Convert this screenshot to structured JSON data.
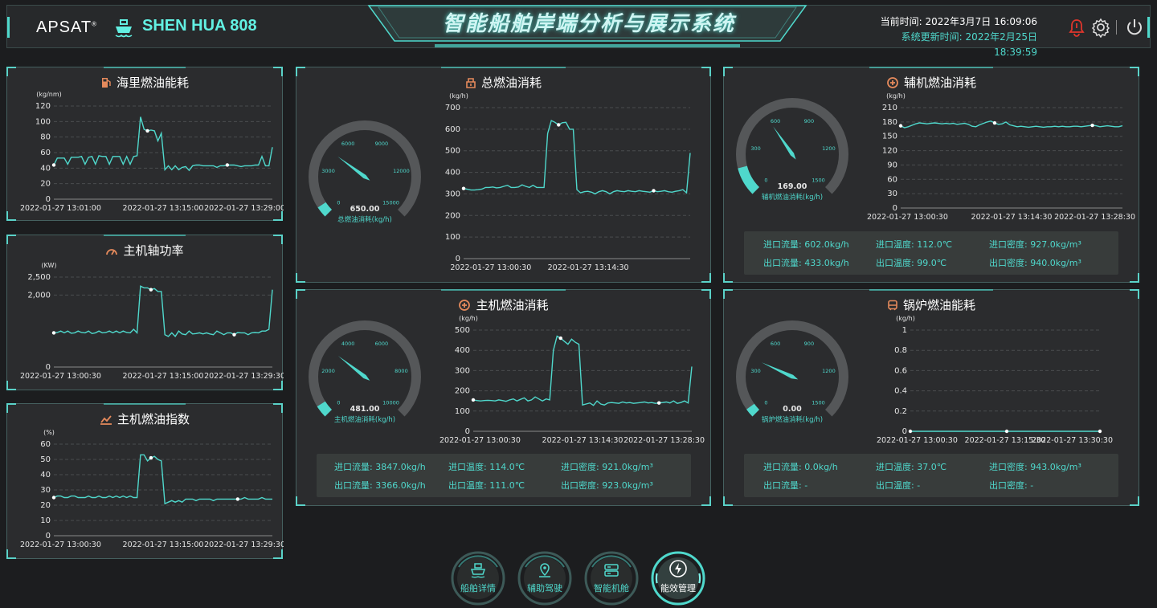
{
  "header": {
    "logo": "APSAT",
    "ship_name": "SHEN HUA 808",
    "system_name": "智能船舶岸端分析与展示系统",
    "current_time_label": "当前时间:",
    "current_time": "2022年3月7日 16:09:06",
    "update_time_label": "系统更新时间:",
    "update_time": "2022年2月25日 18:39:59",
    "icons": [
      "alarm-icon",
      "gear-icon",
      "power-icon"
    ]
  },
  "colors": {
    "accent": "#4fd8cc",
    "bg": "#1c1d1f",
    "panel": "#2b2c2e",
    "gauge_track": "#555759",
    "icon_orange": "#e58a5c",
    "alarm": "#e0362c"
  },
  "panels": {
    "nm": {
      "title": "海里燃油能耗",
      "icon": "fuel-pump-icon"
    },
    "shaft": {
      "title": "主机轴功率",
      "icon": "speedometer-icon"
    },
    "index": {
      "title": "主机燃油指数",
      "icon": "trend-chart-icon"
    },
    "total": {
      "title": "总燃油消耗",
      "icon": "fuel-tank-icon",
      "gauge": {
        "value_text": "650.00",
        "label": "总燃油消耗(kg/h)",
        "ticks": [
          "0",
          "3000",
          "6000",
          "9000",
          "12000",
          "15000"
        ],
        "value": 650,
        "max": 15000
      }
    },
    "aux": {
      "title": "辅机燃油消耗",
      "icon": "engine-icon",
      "gauge": {
        "value_text": "169.00",
        "label": "辅机燃油消耗(kg/h)",
        "ticks": [
          "0",
          "300",
          "600",
          "900",
          "1200",
          "1500"
        ],
        "value": 169,
        "max": 1500
      },
      "info": {
        "in_flow": "进口流量: 602.0kg/h",
        "in_temp": "进口温度: 112.0℃",
        "in_density": "进口密度: 927.0kg/m³",
        "out_flow": "出口流量: 433.0kg/h",
        "out_temp": "出口温度: 99.0℃",
        "out_density": "出口密度: 940.0kg/m³"
      }
    },
    "main": {
      "title": "主机燃油消耗",
      "icon": "engine-icon",
      "gauge": {
        "value_text": "481.00",
        "label": "主机燃油消耗(kg/h)",
        "ticks": [
          "0",
          "2000",
          "4000",
          "6000",
          "8000",
          "10000"
        ],
        "value": 481,
        "max": 10000
      },
      "info": {
        "in_flow": "进口流量: 3847.0kg/h",
        "in_temp": "进口温度: 114.0℃",
        "in_density": "进口密度: 921.0kg/m³",
        "out_flow": "出口流量: 3366.0kg/h",
        "out_temp": "出口温度: 111.0℃",
        "out_density": "出口密度: 923.0kg/m³"
      }
    },
    "boiler": {
      "title": "锅炉燃油能耗",
      "icon": "boiler-icon",
      "gauge": {
        "value_text": "0.00",
        "label": "锅炉燃油消耗(kg/h)",
        "ticks": [
          "0",
          "300",
          "600",
          "900",
          "1200",
          "1500"
        ],
        "value": 0,
        "max": 1500
      },
      "info": {
        "in_flow": "进口流量: 0.0kg/h",
        "in_temp": "进口温度: 37.0℃",
        "in_density": "进口密度: 943.0kg/m³",
        "out_flow": "出口流量: -",
        "out_temp": "出口温度: -",
        "out_density": "出口密度: -"
      }
    }
  },
  "nav": [
    {
      "label": "船舶详情",
      "icon": "ship-icon",
      "active": false
    },
    {
      "label": "辅助驾驶",
      "icon": "location-pin-icon",
      "active": false
    },
    {
      "label": "智能机舱",
      "icon": "server-icon",
      "active": false
    },
    {
      "label": "能效管理",
      "icon": "lightning-icon",
      "active": true
    }
  ],
  "chart_data": [
    {
      "id": "nm",
      "type": "line",
      "unit": "(kg/nm)",
      "ylim": [
        0,
        120
      ],
      "yticks": [
        "0",
        "20",
        "40",
        "60",
        "80",
        "100",
        "120"
      ],
      "xtick_labels": [
        "2022-01-27 13:01:00",
        "2022-01-27 13:15:00",
        "2022-01-27 13:29:00"
      ],
      "values": [
        44,
        53,
        53,
        53,
        45,
        54,
        54,
        54,
        55,
        45,
        54,
        55,
        45,
        56,
        55,
        55,
        45,
        55,
        55,
        55,
        45,
        55,
        45,
        55,
        56,
        106,
        90,
        88,
        89,
        88,
        75,
        85,
        38,
        43,
        38,
        43,
        38,
        41,
        42,
        37,
        43,
        44,
        44,
        43,
        43,
        43,
        43,
        41,
        43,
        43,
        44,
        44,
        44,
        43,
        42,
        43,
        43,
        43,
        44,
        44,
        55,
        43,
        43,
        67
      ],
      "markers": [
        0,
        27,
        50
      ]
    },
    {
      "id": "shaft",
      "type": "line",
      "unit": "(KW)",
      "ylim": [
        0,
        2500
      ],
      "yticks": [
        "0",
        "2,000",
        "2,500"
      ],
      "ytick_values": [
        0,
        2000,
        2500
      ],
      "xtick_labels": [
        "2022-01-27 13:00:30",
        "2022-01-27 13:15:00",
        "2022-01-27 13:29:30"
      ],
      "values": [
        950,
        960,
        1000,
        950,
        1000,
        940,
        950,
        1000,
        960,
        950,
        1000,
        930,
        950,
        1000,
        950,
        960,
        1000,
        950,
        1000,
        950,
        1000,
        960,
        950,
        1050,
        950,
        2250,
        2200,
        2200,
        2150,
        2180,
        2100,
        2100,
        900,
        850,
        950,
        850,
        1000,
        920,
        900,
        1000,
        920,
        930,
        950,
        920,
        950,
        920,
        900,
        1000,
        950,
        900,
        950,
        950,
        900,
        960,
        950,
        950,
        900,
        950,
        960,
        950,
        1000,
        1000,
        1050,
        2150
      ],
      "markers": [
        0,
        28,
        52
      ]
    },
    {
      "id": "index",
      "type": "line",
      "unit": "(%)",
      "ylim": [
        0,
        60
      ],
      "yticks": [
        "0",
        "10",
        "20",
        "30",
        "40",
        "50",
        "60"
      ],
      "xtick_labels": [
        "2022-01-27 13:00:30",
        "2022-01-27 13:15:00",
        "2022-01-27 13:29:30"
      ],
      "values": [
        25,
        26,
        26,
        25,
        25,
        26,
        26,
        25,
        25,
        25,
        26,
        25,
        25,
        26,
        25,
        25,
        26,
        25,
        26,
        25,
        26,
        25,
        26,
        25,
        25,
        53,
        53,
        49,
        51,
        52,
        50,
        49,
        21,
        22,
        23,
        22,
        23,
        22,
        24,
        24,
        24,
        23,
        24,
        24,
        24,
        24,
        23,
        24,
        24,
        24,
        24,
        24,
        24,
        24,
        24,
        25,
        24,
        24,
        24,
        24,
        25,
        24,
        24,
        24
      ],
      "markers": [
        0,
        28,
        53
      ]
    },
    {
      "id": "total",
      "type": "line",
      "unit": "(kg/h)",
      "ylim": [
        0,
        700
      ],
      "yticks": [
        "0",
        "100",
        "200",
        "300",
        "400",
        "500",
        "600",
        "700"
      ],
      "xtick_labels": [
        "2022-01-27 13:00:30",
        "2022-01-27 13:14:30"
      ],
      "values": [
        325,
        322,
        318,
        318,
        320,
        322,
        330,
        330,
        332,
        328,
        330,
        335,
        340,
        330,
        330,
        332,
        342,
        335,
        330,
        340,
        330,
        330,
        330,
        580,
        640,
        632,
        620,
        630,
        632,
        600,
        600,
        320,
        305,
        310,
        312,
        308,
        300,
        310,
        315,
        310,
        300,
        310,
        315,
        312,
        310,
        315,
        312,
        310,
        315,
        312,
        310,
        308,
        315,
        310,
        312,
        315,
        310,
        308,
        312,
        315,
        320,
        305,
        490
      ],
      "markers": [
        0,
        26,
        52
      ]
    },
    {
      "id": "aux",
      "type": "line",
      "unit": "(kg/h)",
      "ylim": [
        0,
        210
      ],
      "yticks": [
        "0",
        "30",
        "60",
        "90",
        "120",
        "150",
        "180",
        "210"
      ],
      "xtick_labels": [
        "2022-01-27 13:00:30",
        "2022-01-27 13:14:30",
        "2022-01-27 13:28:30"
      ],
      "values": [
        172,
        168,
        170,
        173,
        176,
        178,
        177,
        176,
        177,
        178,
        177,
        176,
        177,
        176,
        177,
        175,
        176,
        177,
        175,
        171,
        170,
        174,
        177,
        180,
        182,
        178,
        175,
        176,
        180,
        174,
        172,
        170,
        171,
        170,
        169,
        170,
        171,
        170,
        169,
        170,
        170,
        171,
        170,
        171,
        170,
        170,
        171,
        171,
        170,
        171,
        172,
        173,
        172,
        170,
        171,
        172,
        171,
        170,
        170,
        172
      ],
      "markers": [
        0,
        25,
        51
      ]
    },
    {
      "id": "main",
      "type": "line",
      "unit": "(kg/h)",
      "ylim": [
        0,
        500
      ],
      "yticks": [
        "0",
        "100",
        "200",
        "300",
        "400",
        "500"
      ],
      "xtick_labels": [
        "2022-01-27 13:00:30",
        "2022-01-27 13:14:30",
        "2022-01-27 13:28:30"
      ],
      "values": [
        155,
        152,
        150,
        152,
        153,
        152,
        150,
        155,
        152,
        148,
        155,
        160,
        150,
        158,
        165,
        150,
        155,
        170,
        160,
        150,
        160,
        155,
        400,
        470,
        460,
        445,
        430,
        455,
        440,
        430,
        130,
        135,
        140,
        128,
        150,
        135,
        130,
        140,
        142,
        140,
        138,
        145,
        140,
        142,
        138,
        140,
        142,
        145,
        140,
        142,
        138,
        140,
        142,
        145,
        140,
        150,
        138,
        142,
        150,
        140,
        320
      ],
      "markers": [
        0,
        24,
        51
      ]
    },
    {
      "id": "boiler",
      "type": "line",
      "unit": "(kg/h)",
      "ylim": [
        0,
        1
      ],
      "yticks": [
        "0",
        "0.2",
        "0.4",
        "0.6",
        "0.8",
        "1"
      ],
      "xtick_labels": [
        "2022-01-27 13:00:30",
        "2022-01-27 13:15:30",
        "2022-01-27 13:30:30"
      ],
      "values": [
        0,
        0,
        0,
        0,
        0,
        0,
        0,
        0,
        0,
        0,
        0,
        0,
        0,
        0,
        0,
        0,
        0,
        0,
        0,
        0,
        0,
        0,
        0,
        0,
        0,
        0,
        0,
        0,
        0,
        0,
        0,
        0,
        0,
        0,
        0,
        0,
        0,
        0,
        0,
        0,
        0,
        0,
        0,
        0,
        0,
        0,
        0,
        0,
        0,
        0,
        0,
        0,
        0,
        0,
        0,
        0,
        0,
        0,
        0,
        0
      ],
      "markers": [
        0,
        30,
        59
      ]
    }
  ]
}
